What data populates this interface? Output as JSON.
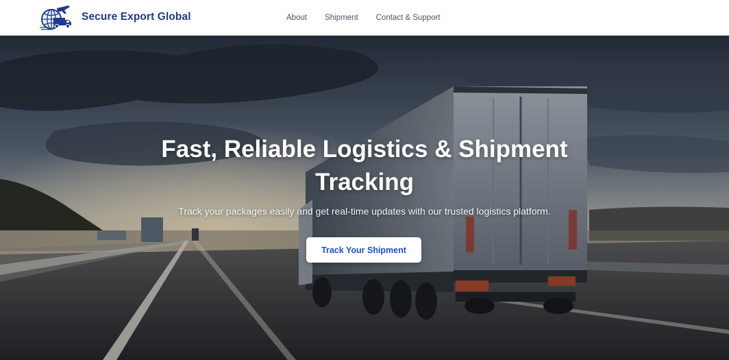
{
  "header": {
    "brand_name": "Secure Export Global",
    "logo_icon": "globe-truck-plane-logo-icon",
    "nav": [
      {
        "label": "About"
      },
      {
        "label": "Shipment"
      },
      {
        "label": "Contact & Support"
      }
    ]
  },
  "hero": {
    "title": "Fast, Reliable Logistics & Shipment Tracking",
    "subtitle": "Track your packages easily and get real-time updates with our trusted logistics platform.",
    "cta_label": "Track Your Shipment",
    "background_image": "truck-on-highway-at-sunset"
  },
  "colors": {
    "brand": "#1e3a8a",
    "nav_text": "#4b5563",
    "cta_text": "#1d4ed8",
    "hero_text": "#ffffff"
  }
}
